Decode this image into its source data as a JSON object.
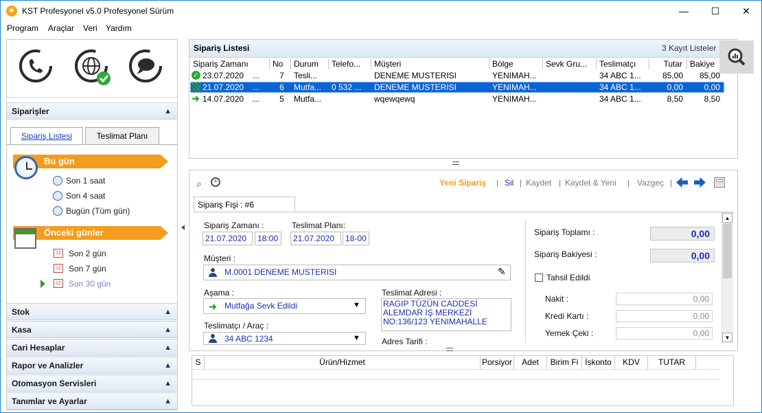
{
  "window": {
    "title": "KST Profesyonel v5.0 Profesyonel Sürüm",
    "minimize": "—",
    "maximize": "☐",
    "close": "✕"
  },
  "menu": [
    "Program",
    "Araçlar",
    "Veri",
    "Yardım"
  ],
  "sidebar": {
    "siparisler_title": "Siparişler",
    "tabs": [
      "Sipariş Listesi",
      "Teslimat Planı"
    ],
    "bugun": {
      "title": "Bu gün",
      "items": [
        "Son 1 saat",
        "Son 4 saat",
        "Bugün (Tüm gün)"
      ]
    },
    "onceki": {
      "title": "Önceki günler",
      "items": [
        "Son 2 gün",
        "Son 7 gün",
        "Son 30 gün"
      ]
    },
    "sections": [
      "Stok",
      "Kasa",
      "Cari Hesaplar",
      "Rapor ve Analizler",
      "Otomasyon Servisleri",
      "Tanımlar ve Ayarlar"
    ]
  },
  "order_list": {
    "title": "Sipariş Listesi",
    "count": "3 Kayıt Listeler",
    "columns": [
      "Sipariş Zamanı",
      "No",
      "Durum",
      "Telefo...",
      "Müşteri",
      "Bölge",
      "Sevk Gru...",
      "Teslimatçı",
      "Tutar",
      "Bakiye"
    ],
    "rows": [
      {
        "zaman": "23.07.2020",
        "dots": "...",
        "no": "7",
        "durum": "Tesli...",
        "telefon": "",
        "musteri": "DENEME MUSTERISI",
        "bolge": "YENIMAH...",
        "sevk": "",
        "teslimatci": "34 ABC 1...",
        "tutar": "85,00",
        "bakiye": "85,00"
      },
      {
        "zaman": "21.07.2020",
        "dots": "...",
        "no": "6",
        "durum": "Mutfa...",
        "telefon": "0 532 ...",
        "musteri": "DENEME MUSTERISI",
        "bolge": "YENIMAH...",
        "sevk": "",
        "teslimatci": "34 ABC 1...",
        "tutar": "0,00",
        "bakiye": "0,00"
      },
      {
        "zaman": "14.07.2020",
        "dots": "...",
        "no": "5",
        "durum": "Mutfa...",
        "telefon": "",
        "musteri": "wqewqewq",
        "bolge": "YENIMAH...",
        "sevk": "",
        "teslimatci": "34 ABC 1...",
        "tutar": "8,50",
        "bakiye": "8,50"
      }
    ]
  },
  "toolbar": {
    "yeni": "Yeni Sipariş",
    "sil": "Sil",
    "kaydet": "Kaydet",
    "kaydet_yeni": "Kaydet & Yeni",
    "vazgec": "Vazgeç",
    "sep": "|"
  },
  "form": {
    "tab": "Sipariş Fişi : #6",
    "siparis_zamani_label": "Sipariş Zamanı :",
    "siparis_tarih": "21.07.2020",
    "siparis_saat": "18:00",
    "teslimat_plani_label": "Teslimat Planı:",
    "teslimat_tarih": "21.07.2020",
    "teslimat_saat": "18-00",
    "musteri_label": "Müşteri :",
    "musteri": "M.0001 DENEME MUSTERISI",
    "asama_label": "Aşama :",
    "asama": "Mutfağa Sevk Edildi",
    "teslimatci_label": "Teslimatçı / Araç :",
    "teslimatci": "34 ABC 1234",
    "adres_label": "Teslimat Adresi :",
    "adres_lines": [
      "RAGIP TÜZÜN CADDESİ",
      "ALEMDAR İŞ MERKEZİ",
      "NO:136/123 YENIMAHALLE"
    ],
    "adres_tarifi_label": "Adres Tarifi :",
    "toplam_label": "Sipariş Toplamı :",
    "toplam": "0,00",
    "bakiye_label": "Sipariş Bakiyesi :",
    "bakiye": "0,00",
    "tahsil_label": "Tahsil Edildi",
    "nakit_label": "Nakit :",
    "nakit": "0,00",
    "kredi_label": "Kredi Kartı :",
    "kredi": "0,00",
    "yemek_label": "Yemek Çeki :",
    "yemek": "0,00"
  },
  "items_grid": {
    "columns": [
      "S",
      "Ürün/Hizmet",
      "Porsiyor",
      "Adet",
      "Birim Fi",
      "İskonto",
      "KDV",
      "TUTAR"
    ]
  },
  "colors": {
    "accent_orange": "#f39c1e",
    "selection_blue": "#0a64d6",
    "link_blue": "#1a2fb0"
  }
}
